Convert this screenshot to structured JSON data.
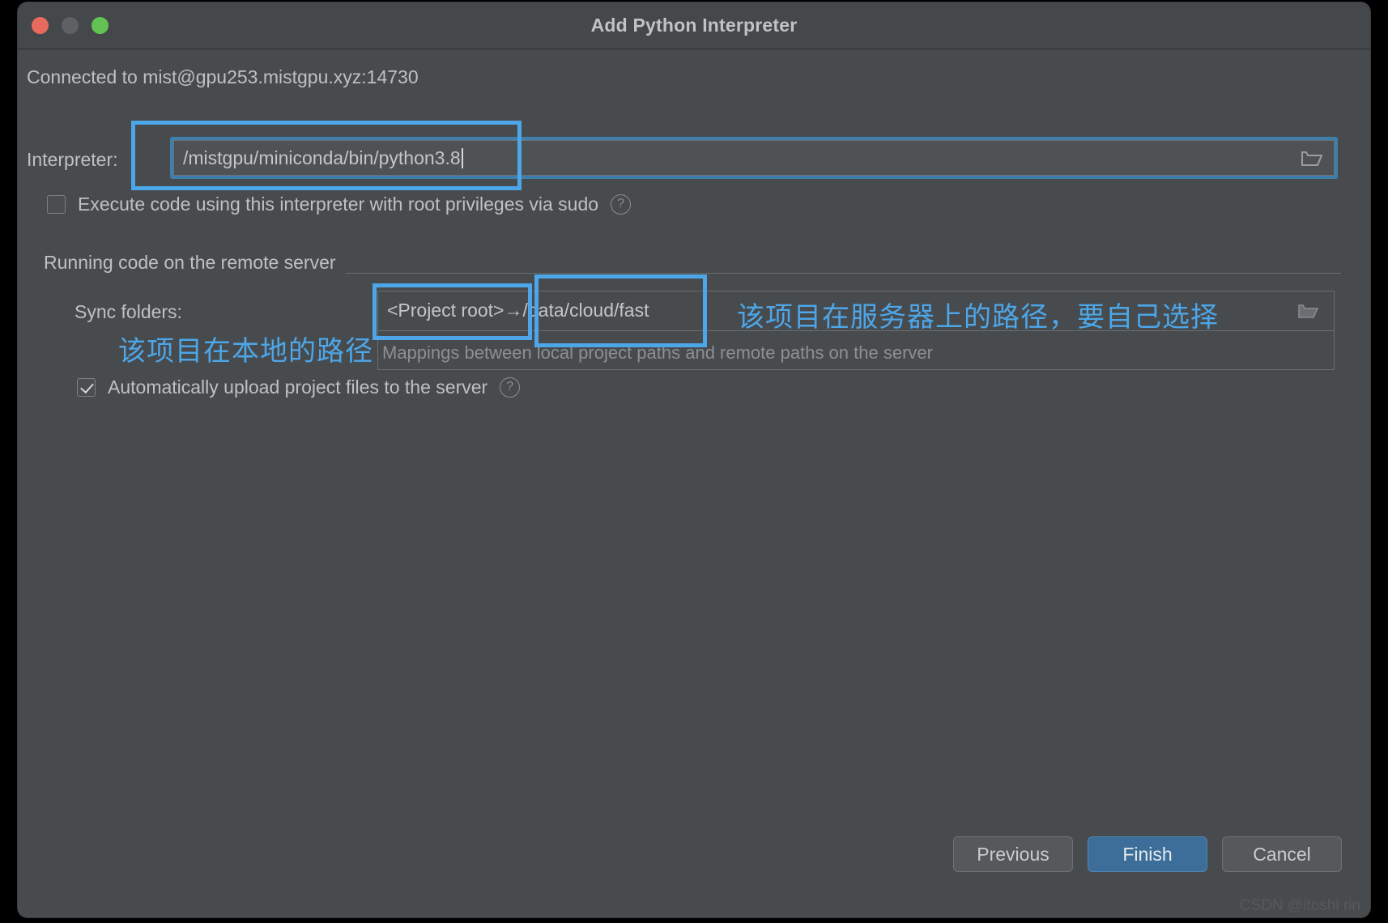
{
  "window": {
    "title": "Add Python Interpreter",
    "controls": {
      "close": "close-button",
      "minimize": "minimize-button",
      "zoom": "zoom-button"
    },
    "colors": {
      "close": "#E8695E",
      "minimize": "#5E6164",
      "zoom": "#62C354",
      "panel": "#474B4E",
      "titlebar": "#45484A",
      "accent_primary_button": "#3D6E99",
      "annotation": "#4DA6E8",
      "focus_ring": "#3E7FAE"
    }
  },
  "connection": {
    "status_text": "Connected to mist@gpu253.mistgpu.xyz:14730"
  },
  "interpreter": {
    "label": "Interpreter:",
    "value": "/mistgpu/miniconda/bin/python3.8",
    "browse_icon": "folder-icon"
  },
  "sudo": {
    "label": "Execute code using this interpreter with root privileges via sudo",
    "checked": false,
    "help_icon": "help-icon"
  },
  "remote_group": {
    "title": "Running code on the remote server",
    "sync_folders": {
      "label": "Sync folders:",
      "rows": [
        {
          "local": "<Project root>",
          "arrow": "→",
          "remote": "/data/cloud/fast"
        },
        {
          "local": "",
          "arrow": "",
          "remote": ""
        }
      ],
      "display_value": "<Project root>→/data/cloud/fast",
      "browse_icon": "folder-icon"
    },
    "mappings_hint": "Mappings between local project paths and remote paths on the server",
    "auto_upload": {
      "label": "Automatically upload project files to the server",
      "checked": true,
      "help_icon": "help-icon"
    }
  },
  "annotations": {
    "local_path_note": "该项目在本地的路径",
    "remote_path_note": "该项目在服务器上的路径，要自己选择"
  },
  "footer": {
    "previous_label": "Previous",
    "finish_label": "Finish",
    "cancel_label": "Cancel"
  },
  "watermark": {
    "text": "CSDN @itoshi rin"
  }
}
